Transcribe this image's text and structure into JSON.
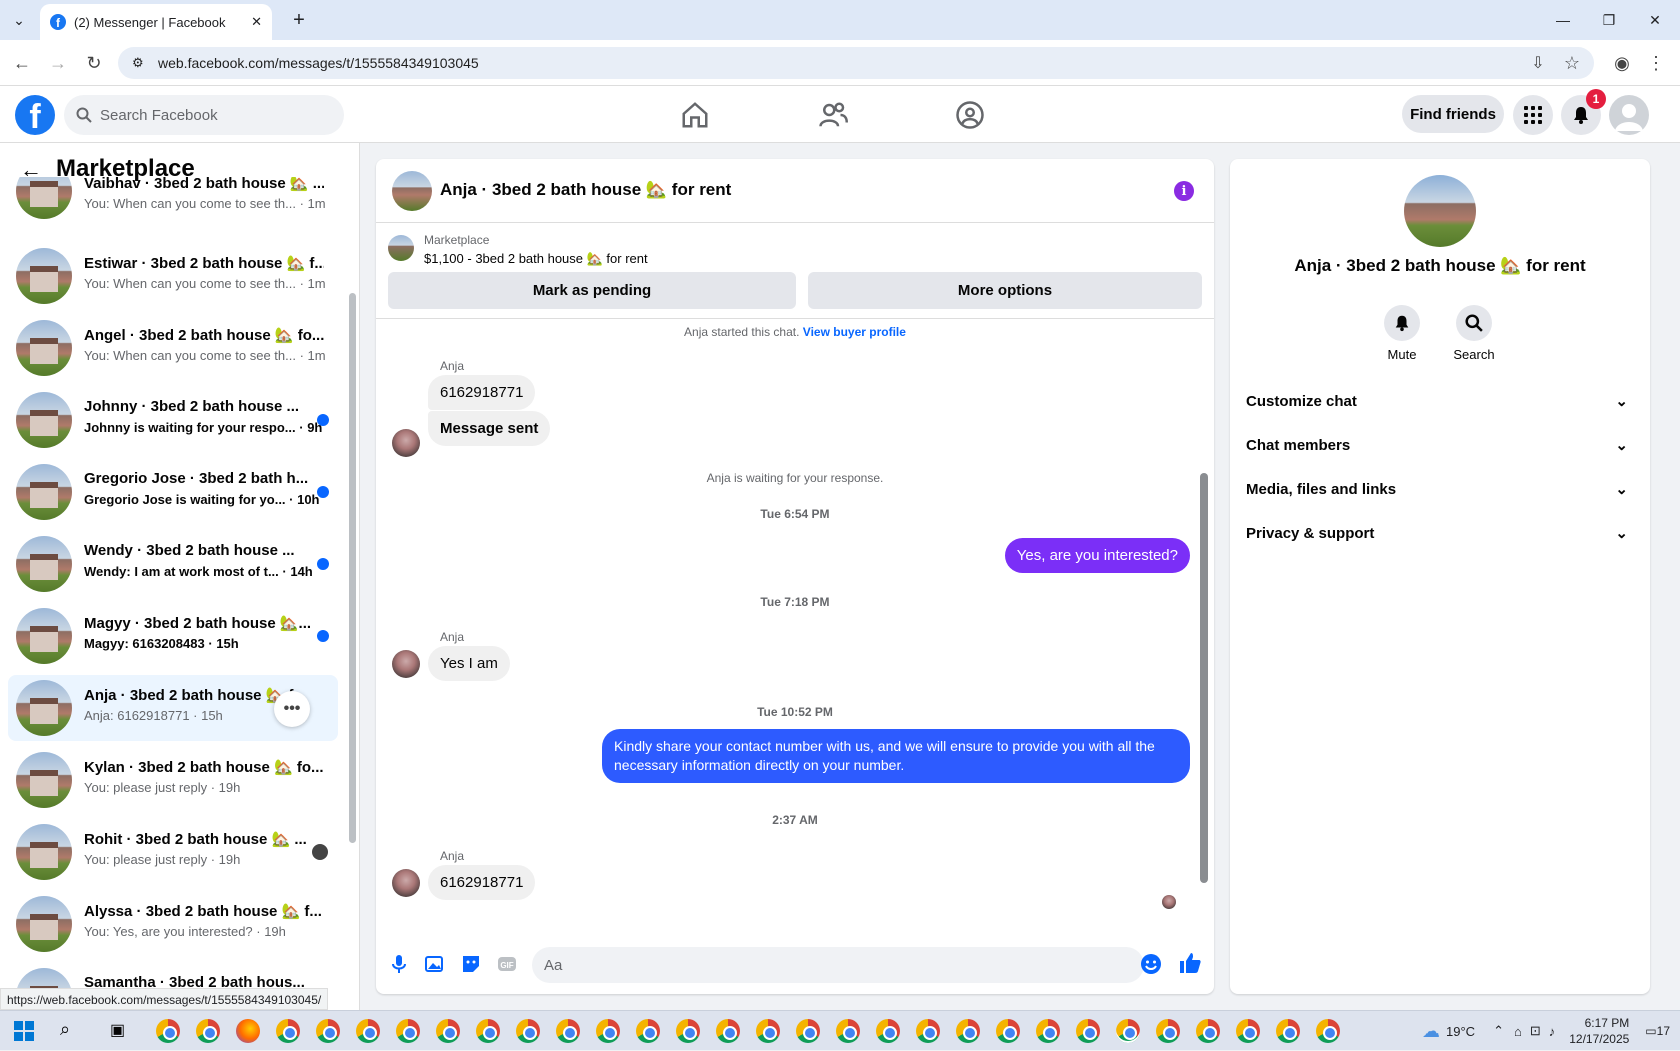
{
  "browser": {
    "tab_title": "(2) Messenger | Facebook",
    "tab_close": "✕",
    "new_tab": "+",
    "url": "web.facebook.com/messages/t/1555584349103045",
    "status_url": "https://web.facebook.com/messages/t/1555584349103045/"
  },
  "header": {
    "search_placeholder": "Search Facebook",
    "find_friends": "Find friends",
    "notif_count": "1"
  },
  "sidebar": {
    "title": "Marketplace",
    "conversations": [
      {
        "name": "Vaibhav · 3bed 2 bath house 🏡 ...",
        "snippet": "You: When can you come to see th... · 1m"
      },
      {
        "name": "Estiwar · 3bed 2 bath house 🏡 f...",
        "snippet": "You: When can you come to see th... · 1m"
      },
      {
        "name": "Angel · 3bed 2 bath house 🏡 fo...",
        "snippet": "You: When can you come to see th... · 1m"
      },
      {
        "name": "Johnny · 3bed 2 bath house ...",
        "snippet": "Johnny is waiting for your respo... · 9h"
      },
      {
        "name": "Gregorio Jose · 3bed 2 bath h...",
        "snippet": "Gregorio Jose is waiting for yo... · 10h"
      },
      {
        "name": "Wendy · 3bed 2 bath house ...",
        "snippet": "Wendy: I am at work most of t... · 14h"
      },
      {
        "name": "Magyy · 3bed 2 bath house 🏡...",
        "snippet": "Magyy: 6163208483 · 15h"
      },
      {
        "name": "Anja · 3bed 2 bath house 🏡 f...",
        "snippet": "Anja: 6162918771 · 15h"
      },
      {
        "name": "Kylan · 3bed 2 bath house 🏡 fo...",
        "snippet": "You: please just reply · 19h"
      },
      {
        "name": "Rohit · 3bed 2 bath house 🏡 ...",
        "snippet": "You: please just reply · 19h"
      },
      {
        "name": "Alyssa · 3bed 2 bath house 🏡 f...",
        "snippet": "You: Yes, are you interested? · 19h"
      },
      {
        "name": "Samantha · 3bed 2 bath hous...",
        "snippet": ""
      }
    ]
  },
  "chat": {
    "title": "Anja · 3bed 2 bath house 🏡 for rent",
    "listing_source": "Marketplace",
    "listing_price": "$1,100 - 3bed 2 bath house 🏡 for rent",
    "btn_pending": "Mark as pending",
    "btn_more": "More options",
    "started": "Anja started this chat.",
    "view_profile": "View buyer profile",
    "sender": "Anja",
    "msg1": "6162918771",
    "msg2": "Message sent",
    "waiting": "Anja is waiting for your response.",
    "ts1": "Tue 6:54 PM",
    "out1": "Yes, are you interested?",
    "ts2": "Tue 7:18 PM",
    "msg3": "Yes I am",
    "ts3": "Tue 10:52 PM",
    "out2": "Kindly share your contact number with us, and we will ensure to provide you with all the necessary information directly on your number.",
    "ts4": "2:37 AM",
    "msg4": "6162918771",
    "input_placeholder": "Aa",
    "accent_purple": "#7b2ff7",
    "accent_blue": "#2d5bff"
  },
  "details": {
    "title": "Anja · 3bed 2 bath house 🏡 for rent",
    "mute": "Mute",
    "search": "Search",
    "sections": [
      "Customize chat",
      "Chat members",
      "Media, files and links",
      "Privacy & support"
    ]
  },
  "taskbar": {
    "weather": "19°C",
    "time": "6:17 PM",
    "date": "12/17/2025",
    "notif": "17"
  }
}
